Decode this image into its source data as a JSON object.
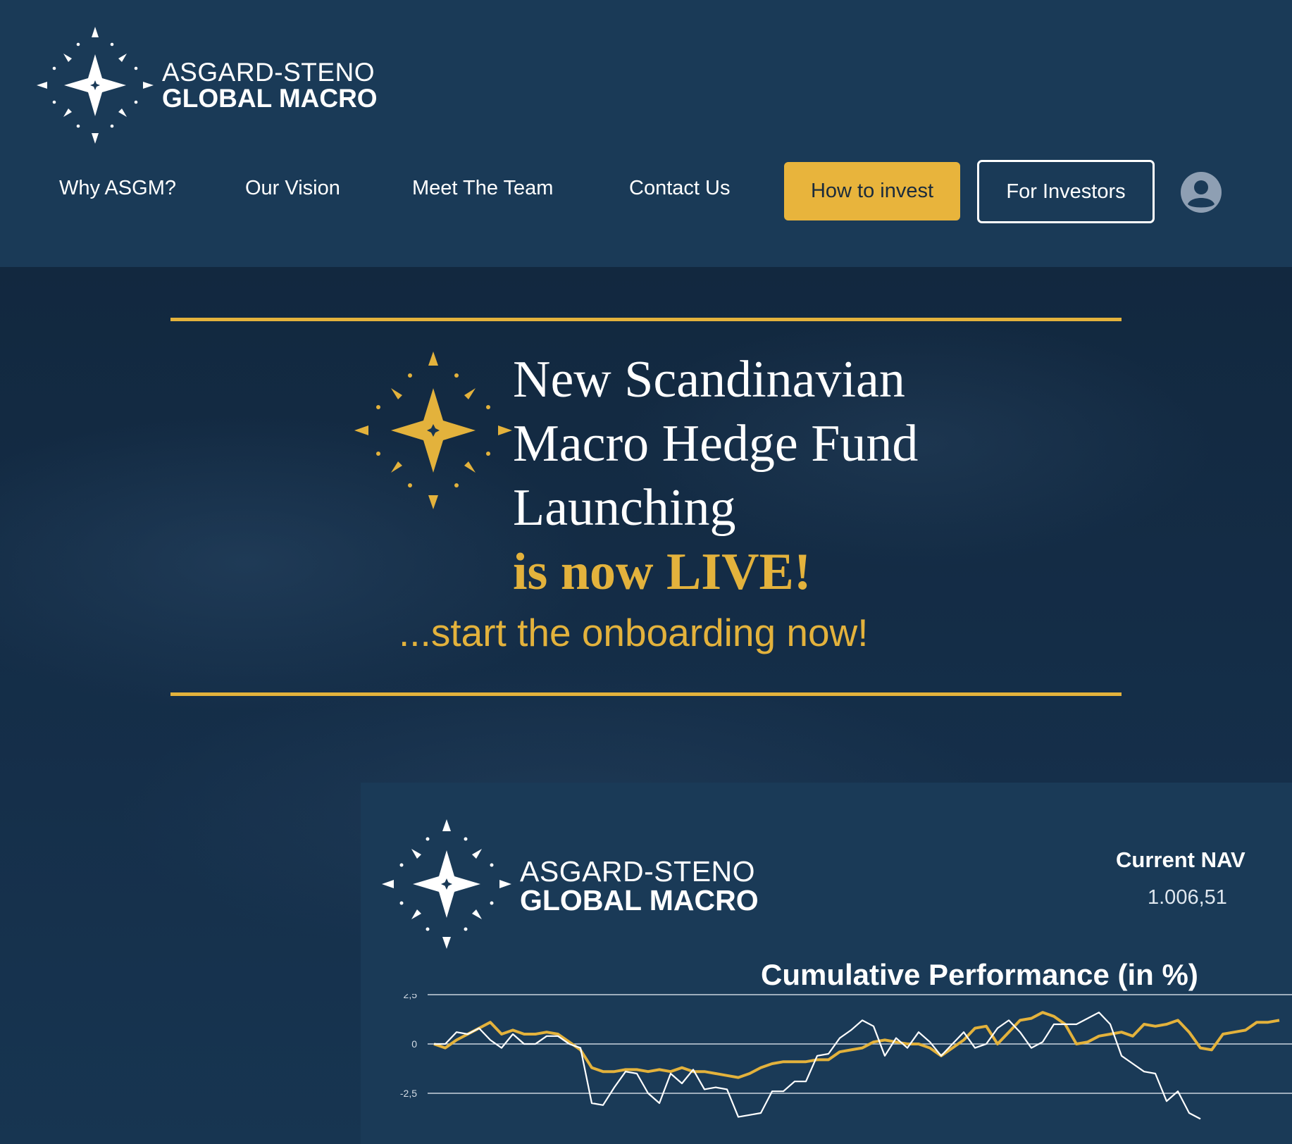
{
  "brand": {
    "line1": "ASGARD-STENO",
    "line2": "GLOBAL MACRO",
    "colors": {
      "navy": "#1a3a57",
      "gold": "#e3b23c"
    },
    "icon": "compass-star-icon"
  },
  "nav": {
    "items": [
      {
        "label": "Why ASGM?"
      },
      {
        "label": "Our Vision"
      },
      {
        "label": "Meet The Team"
      },
      {
        "label": "Contact Us"
      }
    ],
    "invest_label": "How to invest",
    "investors_label": "For Investors",
    "account_icon": "user-account-icon"
  },
  "hero": {
    "headline": [
      "New Scandinavian",
      "Macro Hedge Fund",
      "Launching"
    ],
    "live": "is now LIVE!",
    "subline": "...start the onboarding now!"
  },
  "panel": {
    "nav_label": "Current NAV",
    "nav_value": "1.006,51",
    "chart_title": "Cumulative Performance (in %)"
  },
  "chart_data": {
    "type": "line",
    "title": "Cumulative Performance (in %)",
    "yticks": [
      "2,5",
      "0",
      "-2,5"
    ],
    "ylim": [
      -3.8,
      2.5
    ],
    "grid": true,
    "series": [
      {
        "color": "#e3b23c",
        "values": [
          0,
          -0.2,
          0.2,
          0.5,
          0.8,
          1.1,
          0.5,
          0.7,
          0.5,
          0.5,
          0.6,
          0.5,
          0.1,
          -0.3,
          -1.2,
          -1.4,
          -1.4,
          -1.3,
          -1.3,
          -1.4,
          -1.3,
          -1.4,
          -1.2,
          -1.4,
          -1.4,
          -1.5,
          -1.6,
          -1.7,
          -1.5,
          -1.2,
          -1.0,
          -0.9,
          -0.9,
          -0.9,
          -0.8,
          -0.8,
          -0.4,
          -0.3,
          -0.2,
          0.1,
          0.2,
          0.1,
          0.0,
          0.0,
          -0.2,
          -0.6,
          -0.2,
          0.2,
          0.8,
          0.9,
          0.0,
          0.6,
          1.2,
          1.3,
          1.6,
          1.4,
          1.0,
          0.0,
          0.1,
          0.4,
          0.5,
          0.6,
          0.4,
          1.0,
          0.9,
          1.0,
          1.2,
          0.6,
          -0.2,
          -0.3,
          0.5,
          0.6,
          0.7,
          1.1,
          1.1,
          1.2
        ]
      },
      {
        "color": "#ffffff",
        "values": [
          0,
          0,
          0.6,
          0.5,
          0.8,
          0.2,
          -0.2,
          0.5,
          0.0,
          0.0,
          0.4,
          0.4,
          0.0,
          -0.2,
          -3.0,
          -3.1,
          -2.2,
          -1.4,
          -1.5,
          -2.5,
          -3.0,
          -1.5,
          -2.0,
          -1.3,
          -2.3,
          -2.2,
          -2.3,
          -3.7,
          -3.6,
          -3.5,
          -2.4,
          -2.4,
          -1.9,
          -1.9,
          -0.6,
          -0.5,
          0.3,
          0.7,
          1.2,
          0.9,
          -0.6,
          0.3,
          -0.2,
          0.6,
          0.1,
          -0.6,
          0.0,
          0.6,
          -0.2,
          0.0,
          0.8,
          1.2,
          0.6,
          -0.2,
          0.1,
          1.0,
          1.0,
          1.0,
          1.3,
          1.6,
          1.0,
          -0.6,
          -1.0,
          -1.4,
          -1.5,
          -2.9,
          -2.4,
          -3.5,
          -3.8
        ]
      }
    ]
  }
}
